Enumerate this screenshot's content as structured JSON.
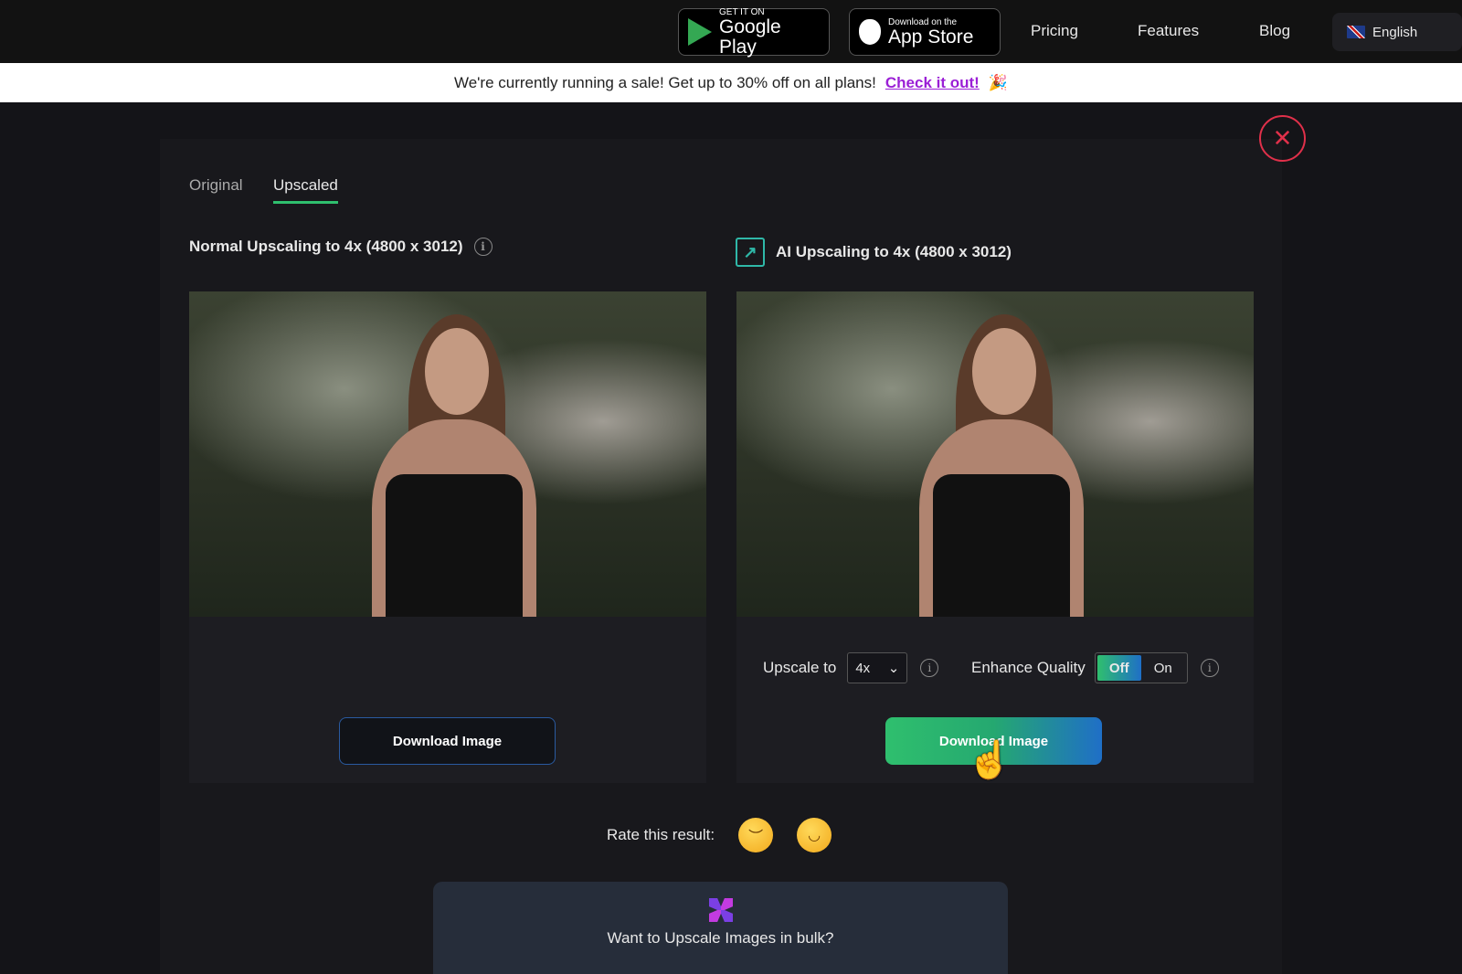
{
  "nav": {
    "google_play": {
      "small": "GET IT ON",
      "big": "Google Play"
    },
    "app_store": {
      "small": "Download on the",
      "big": "App Store"
    },
    "links": [
      "Pricing",
      "Features",
      "Blog"
    ],
    "language": "English"
  },
  "banner": {
    "text": "We're currently running a sale! Get up to 30% off on all plans!",
    "link": "Check it out!",
    "emoji": "🎉"
  },
  "tabs": [
    "Original",
    "Upscaled"
  ],
  "active_tab": "Upscaled",
  "left": {
    "heading": "Normal Upscaling to 4x (4800 x 3012)",
    "download": "Download Image"
  },
  "right": {
    "heading": "AI Upscaling to 4x (4800 x 3012)",
    "upscale_label": "Upscale to",
    "upscale_value": "4x",
    "enhance_label": "Enhance Quality",
    "toggle_off": "Off",
    "toggle_on": "On",
    "toggle_selected": "Off",
    "download": "Download Image"
  },
  "rate": {
    "label": "Rate this result:",
    "options": [
      "😔",
      "😀"
    ]
  },
  "bulk": {
    "text": "Want to Upscale Images in bulk?"
  },
  "colors": {
    "accent_green": "#2fbf6e",
    "accent_blue": "#1f6fc7",
    "close_red": "#e0304a",
    "link_purple": "#9b1fd6"
  }
}
